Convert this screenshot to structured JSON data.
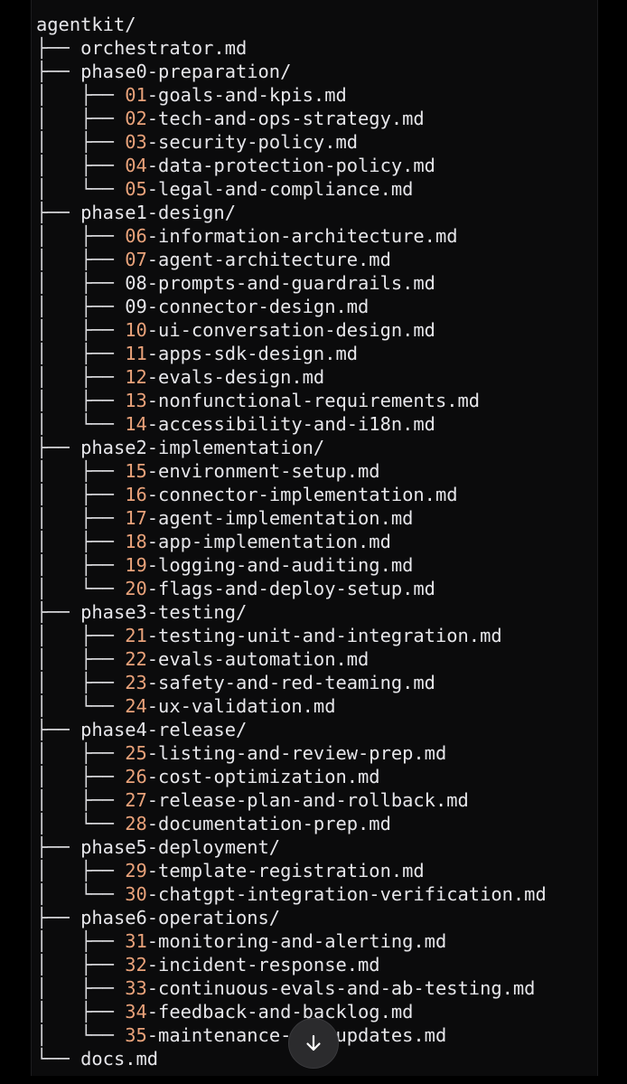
{
  "tree": {
    "root": "agentkit/",
    "entries": [
      {
        "prefix": "├── ",
        "name": "orchestrator.md"
      },
      {
        "prefix": "├── ",
        "name": "phase0-preparation/"
      },
      {
        "prefix": "│   ├── ",
        "num": "01",
        "name": "-goals-and-kpis.md"
      },
      {
        "prefix": "│   ├── ",
        "num": "02",
        "name": "-tech-and-ops-strategy.md"
      },
      {
        "prefix": "│   ├── ",
        "num": "03",
        "name": "-security-policy.md"
      },
      {
        "prefix": "│   ├── ",
        "num": "04",
        "name": "-data-protection-policy.md"
      },
      {
        "prefix": "│   └── ",
        "num": "05",
        "name": "-legal-and-compliance.md"
      },
      {
        "prefix": "├── ",
        "name": "phase1-design/"
      },
      {
        "prefix": "│   ├── ",
        "num": "06",
        "name": "-information-architecture.md"
      },
      {
        "prefix": "│   ├── ",
        "num": "07",
        "name": "-agent-architecture.md"
      },
      {
        "prefix": "│   ├── ",
        "name": "08-prompts-and-guardrails.md"
      },
      {
        "prefix": "│   ├── ",
        "name": "09-connector-design.md"
      },
      {
        "prefix": "│   ├── ",
        "num": "10",
        "name": "-ui-conversation-design.md"
      },
      {
        "prefix": "│   ├── ",
        "num": "11",
        "name": "-apps-sdk-design.md"
      },
      {
        "prefix": "│   ├── ",
        "num": "12",
        "name": "-evals-design.md"
      },
      {
        "prefix": "│   ├── ",
        "num": "13",
        "name": "-nonfunctional-requirements.md"
      },
      {
        "prefix": "│   └── ",
        "num": "14",
        "name": "-accessibility-and-i18n.md"
      },
      {
        "prefix": "├── ",
        "name": "phase2-implementation/"
      },
      {
        "prefix": "│   ├── ",
        "num": "15",
        "name": "-environment-setup.md"
      },
      {
        "prefix": "│   ├── ",
        "num": "16",
        "name": "-connector-implementation.md"
      },
      {
        "prefix": "│   ├── ",
        "num": "17",
        "name": "-agent-implementation.md"
      },
      {
        "prefix": "│   ├── ",
        "num": "18",
        "name": "-app-implementation.md"
      },
      {
        "prefix": "│   ├── ",
        "num": "19",
        "name": "-logging-and-auditing.md"
      },
      {
        "prefix": "│   └── ",
        "num": "20",
        "name": "-flags-and-deploy-setup.md"
      },
      {
        "prefix": "├── ",
        "name": "phase3-testing/"
      },
      {
        "prefix": "│   ├── ",
        "num": "21",
        "name": "-testing-unit-and-integration.md"
      },
      {
        "prefix": "│   ├── ",
        "num": "22",
        "name": "-evals-automation.md"
      },
      {
        "prefix": "│   ├── ",
        "num": "23",
        "name": "-safety-and-red-teaming.md"
      },
      {
        "prefix": "│   └── ",
        "num": "24",
        "name": "-ux-validation.md"
      },
      {
        "prefix": "├── ",
        "name": "phase4-release/"
      },
      {
        "prefix": "│   ├── ",
        "num": "25",
        "name": "-listing-and-review-prep.md"
      },
      {
        "prefix": "│   ├── ",
        "num": "26",
        "name": "-cost-optimization.md"
      },
      {
        "prefix": "│   ├── ",
        "num": "27",
        "name": "-release-plan-and-rollback.md"
      },
      {
        "prefix": "│   └── ",
        "num": "28",
        "name": "-documentation-prep.md"
      },
      {
        "prefix": "├── ",
        "name": "phase5-deployment/"
      },
      {
        "prefix": "│   ├── ",
        "num": "29",
        "name": "-template-registration.md"
      },
      {
        "prefix": "│   └── ",
        "num": "30",
        "name": "-chatgpt-integration-verification.md"
      },
      {
        "prefix": "├── ",
        "name": "phase6-operations/"
      },
      {
        "prefix": "│   ├── ",
        "num": "31",
        "name": "-monitoring-and-alerting.md"
      },
      {
        "prefix": "│   ├── ",
        "num": "32",
        "name": "-incident-response.md"
      },
      {
        "prefix": "│   ├── ",
        "num": "33",
        "name": "-continuous-evals-and-ab-testing.md"
      },
      {
        "prefix": "│   ├── ",
        "num": "34",
        "name": "-feedback-and-backlog.md"
      },
      {
        "prefix": "│   └── ",
        "num": "35",
        "name": "-maintenance-and-updates.md"
      },
      {
        "prefix": "└── ",
        "name": "docs.md"
      }
    ]
  },
  "scroll_button": {
    "icon": "arrow-down-icon"
  },
  "colors": {
    "background": "#000000",
    "panel": "#0b0b0c",
    "text": "#e6e6ea",
    "number_accent": "#e9a27a",
    "scroll_button_bg": "#2b2b2d"
  }
}
